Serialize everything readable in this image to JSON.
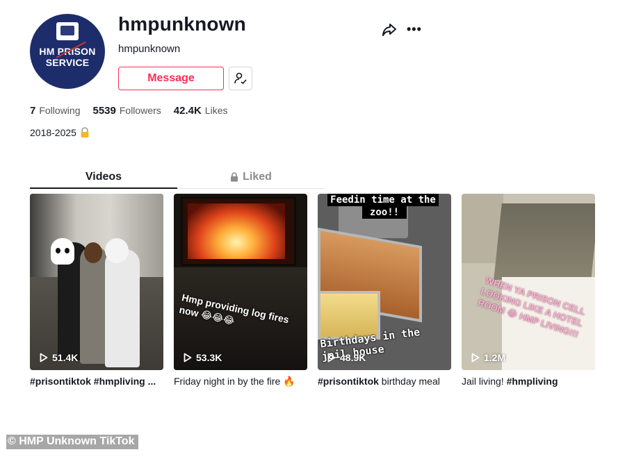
{
  "profile": {
    "username": "hmpunknown",
    "nickname": "hmpunknown",
    "avatar_text_line1": "HM PRISON",
    "avatar_text_line2": "SERVICE",
    "message_label": "Message",
    "stats": {
      "following_count": "7",
      "following_label": "Following",
      "followers_count": "5539",
      "followers_label": "Followers",
      "likes_count": "42.4K",
      "likes_label": "Likes"
    },
    "bio": "2018-2025",
    "bio_emoji": "lock-with-key-emoji"
  },
  "header_icons": [
    "share-icon",
    "more-icon"
  ],
  "tabs": [
    {
      "label": "Videos",
      "active": true
    },
    {
      "label": "Liked",
      "active": false,
      "icon": "lock-icon"
    }
  ],
  "videos": [
    {
      "views": "51.4K",
      "caption": "#prisontiktok #hmpliving ..."
    },
    {
      "views": "53.3K",
      "caption": "Friday night in by the fire 🔥",
      "overlay_text": "Hmp providing log fires now 😂😂😂"
    },
    {
      "views": "48.9K",
      "caption_tag": "#prisontiktok",
      "caption_text": "birthday meal",
      "overlay_top_line1": "Feedin time at the",
      "overlay_top_line2": "zoo!!",
      "overlay_bottom": "Birthdays in the jail house"
    },
    {
      "views": "1.2M",
      "caption_text": "Jail living!",
      "caption_tag": "#hmpliving",
      "overlay_text": "WHEN YA PRISON CELL LOOKING LIKE A HOTEL ROOM 😂 HMP LIVING!!!"
    }
  ],
  "credit": "© HMP Unknown TikTok",
  "colors": {
    "accent": "#fe2c55",
    "text": "#161823",
    "muted": "#8a8b91",
    "avatar_bg": "#1d2d6b"
  }
}
